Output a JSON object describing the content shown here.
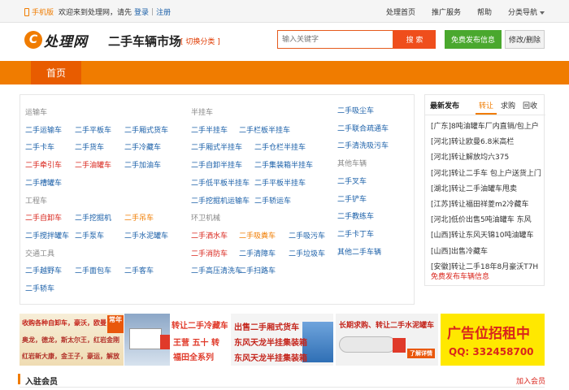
{
  "topbar": {
    "mobile_label": "手机版",
    "welcome": "欢迎来到处理网，请先",
    "login": "登录",
    "separator": "|",
    "register": "注册",
    "links": [
      "处理首页",
      "推广服务",
      "帮助",
      "分类导航"
    ]
  },
  "header": {
    "logo_badge": "C",
    "logo_text": "处理网",
    "title": "二手车辆市场",
    "switch_category": "[ 切换分类 ]",
    "search_placeholder": "输入关键字",
    "search_button": "搜 索",
    "publish_button": "免费发布信息",
    "edit_button": "修改/删除"
  },
  "nav": {
    "home": "首页"
  },
  "categories": {
    "col1": {
      "groups": [
        {
          "heading": "运输车",
          "items": [
            {
              "label": "二手运输车",
              "color": "blue"
            },
            {
              "label": "二手平板车",
              "color": "blue"
            },
            {
              "label": "二手厢式货车",
              "color": "blue"
            },
            {
              "label": "二手卡车",
              "color": "blue"
            },
            {
              "label": "二手货车",
              "color": "blue"
            },
            {
              "label": "二手冷藏车",
              "color": "blue"
            },
            {
              "label": "二手牵引车",
              "color": "red"
            },
            {
              "label": "二手油罐车",
              "color": "red"
            },
            {
              "label": "二手加油车",
              "color": "blue"
            },
            {
              "label": "二手槽罐车",
              "color": "blue"
            }
          ]
        },
        {
          "heading": "工程车",
          "items": [
            {
              "label": "二手自卸车",
              "color": "red"
            },
            {
              "label": "二手挖掘机",
              "color": "blue"
            },
            {
              "label": "二手吊车",
              "color": "orange"
            },
            {
              "label": "二手搅拌罐车",
              "color": "blue"
            },
            {
              "label": "二手泵车",
              "color": "blue"
            },
            {
              "label": "二手水泥罐车",
              "color": "blue"
            }
          ]
        },
        {
          "heading": "交通工具",
          "items": [
            {
              "label": "二手越野车",
              "color": "blue"
            },
            {
              "label": "二手面包车",
              "color": "blue"
            },
            {
              "label": "二手客车",
              "color": "blue"
            },
            {
              "label": "二手轿车",
              "color": "blue"
            }
          ]
        }
      ]
    },
    "col2": {
      "groups": [
        {
          "heading": "半挂车",
          "items": [
            {
              "label": "二手半挂车",
              "color": "blue"
            },
            {
              "label": "二手栏板半挂车",
              "color": "blue"
            },
            {
              "label": "二手厢式半挂车",
              "color": "blue"
            },
            {
              "label": "二手仓栏半挂车",
              "color": "blue"
            },
            {
              "label": "二手自卸半挂车",
              "color": "blue"
            },
            {
              "label": "二手集装箱半挂车",
              "color": "blue"
            },
            {
              "label": "二手低平板半挂车",
              "color": "blue"
            },
            {
              "label": "二手平板半挂车",
              "color": "blue"
            },
            {
              "label": "二手挖掘机运输车",
              "color": "blue"
            },
            {
              "label": "二手轿运车",
              "color": "blue"
            }
          ]
        },
        {
          "heading": "环卫机械",
          "items": [
            {
              "label": "二手洒水车",
              "color": "red"
            },
            {
              "label": "二手吸粪车",
              "color": "orange"
            },
            {
              "label": "二手吸污车",
              "color": "blue"
            },
            {
              "label": "二手消防车",
              "color": "red"
            },
            {
              "label": "二手清障车",
              "color": "blue"
            },
            {
              "label": "二手垃圾车",
              "color": "blue"
            },
            {
              "label": "二手高压清洗车",
              "color": "blue"
            },
            {
              "label": "二手扫路车",
              "color": "blue"
            }
          ]
        }
      ]
    },
    "col3": {
      "groups": [
        {
          "heading": "",
          "items": [
            {
              "label": "二手吸尘车",
              "color": "blue"
            },
            {
              "label": "二手联合疏通车",
              "color": "blue"
            },
            {
              "label": "二手清洗吸污车",
              "color": "blue"
            }
          ]
        },
        {
          "heading": "其他车辆",
          "items": [
            {
              "label": "二手叉车",
              "color": "blue"
            },
            {
              "label": "二手铲车",
              "color": "blue"
            },
            {
              "label": "二手教练车",
              "color": "blue"
            },
            {
              "label": "二手卡丁车",
              "color": "blue"
            },
            {
              "label": "其他二手车辆",
              "color": "blue"
            }
          ]
        }
      ]
    }
  },
  "latest": {
    "title": "最新发布",
    "tabs": [
      "转让",
      "求购",
      "回收"
    ],
    "items": [
      "[广东]8吨油罐车厂内直销/包上户",
      "[河北]转让欧曼6.8米高栏",
      "[河北]转让解放均六375",
      "[河北]转让二手车 包上户送货上门",
      "[湖北]转让二手油罐车甩卖",
      "[江苏]转让福田祥菱m2冷藏车",
      "[河北]低价出售5吨油罐车 东风",
      "[山西]转让东风天锦10吨油罐车",
      "[山西]出售冷藏车",
      "[安徽]转让二手18年8月豪沃T7H"
    ],
    "free_publish": "免费发布车辆信息"
  },
  "ads": {
    "ad1": {
      "lines": [
        "收购各种自卸车，豪沃，欧曼",
        "奥龙，德龙，斯太尔王，红岩金刚",
        "红岩新大康，金王子，豪运，解放"
      ],
      "badge": "常年"
    },
    "ad2": {
      "lines": [
        "转让二手冷藏车",
        "王营 五十 转",
        "福田全系列"
      ]
    },
    "ad3": {
      "lines": [
        "出售二手厢式货车",
        "东风天龙半挂集装箱",
        "东风天龙半挂集装箱"
      ]
    },
    "ad4": {
      "lines": [
        "长期求购、转让二手水泥罐车"
      ],
      "badge": "了解详情"
    },
    "ad5": {
      "lines": [
        "广告位招租中",
        "QQ: 332458700"
      ]
    }
  },
  "members": {
    "title": "入驻会员",
    "join": "加入会员"
  },
  "colors": {
    "brand_orange": "#f07c00",
    "link_blue": "#1a5fa8",
    "hot_red": "#d9251c",
    "green": "#4aa82e"
  }
}
